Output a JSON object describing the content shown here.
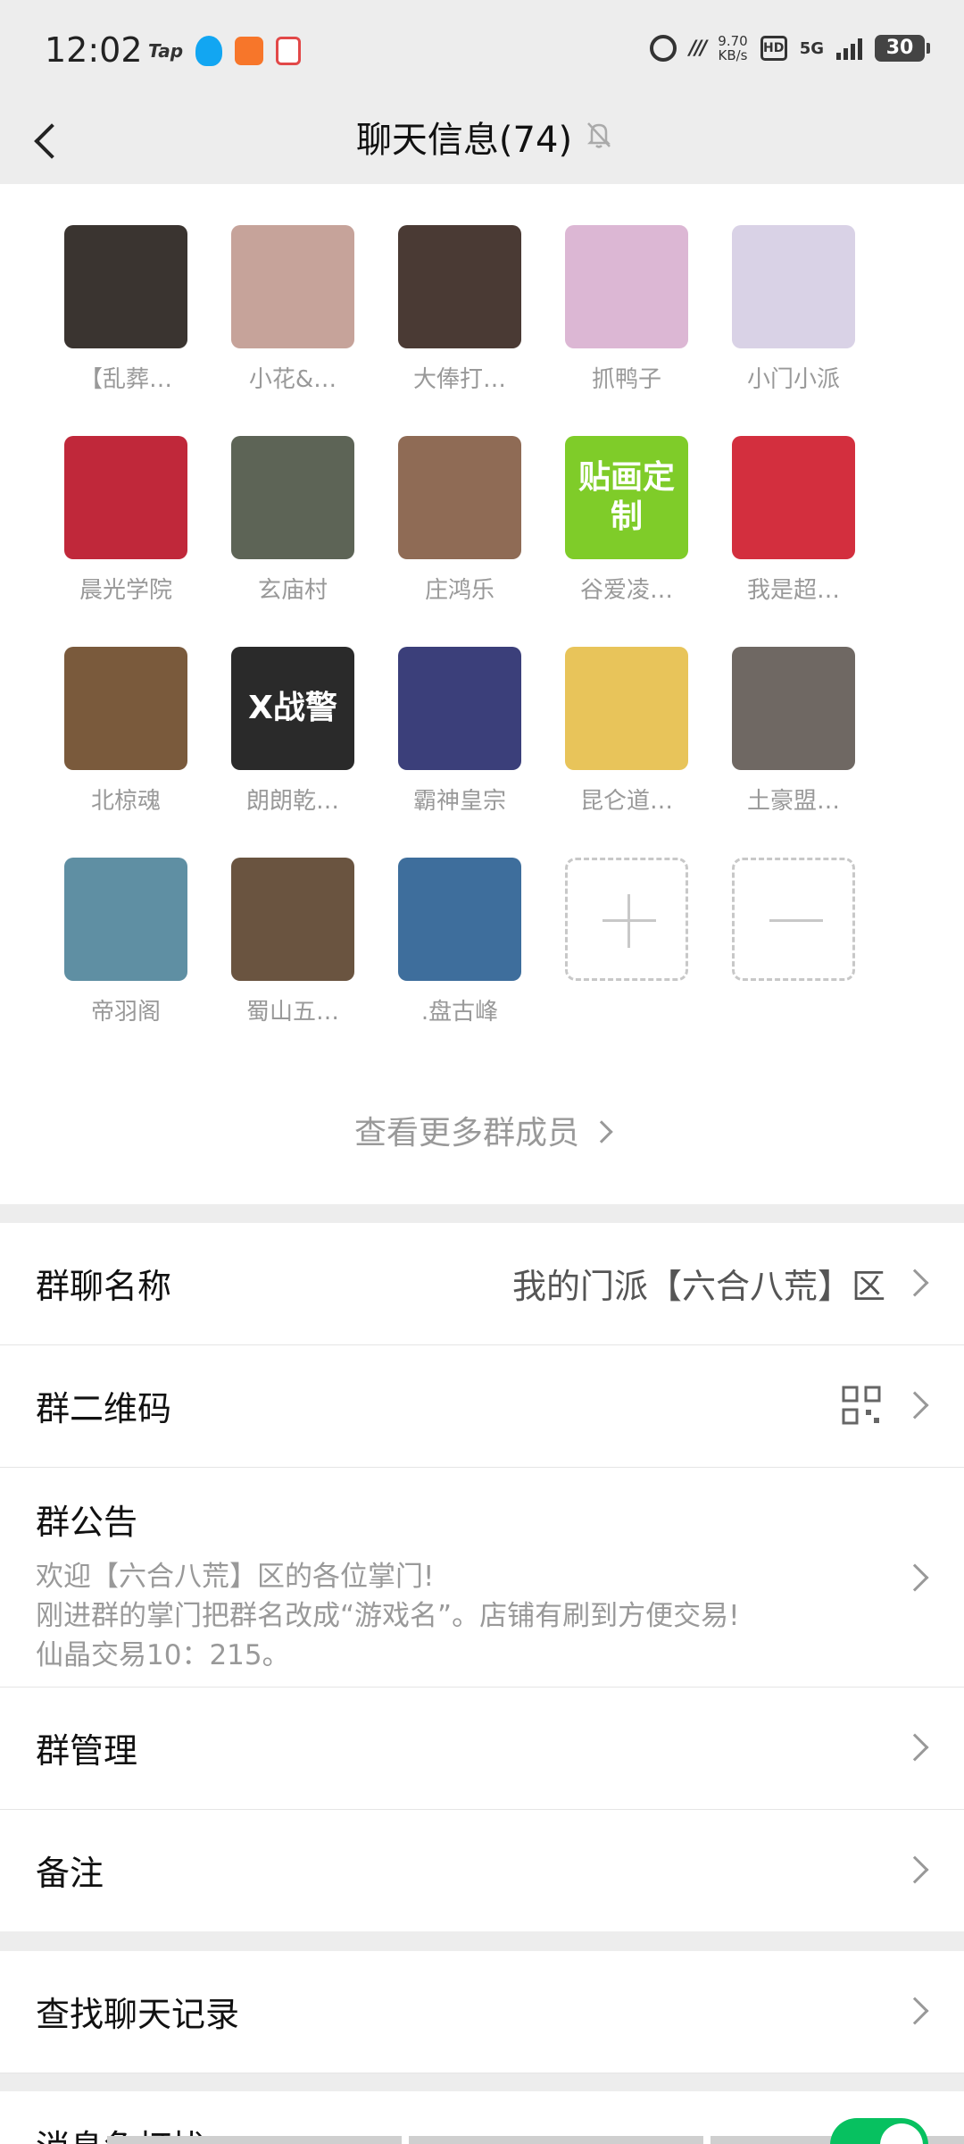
{
  "status_bar": {
    "time": "12:02",
    "app_tap": "Tap",
    "net_speed_value": "9.70",
    "net_speed_unit": "KB/s",
    "hd": "HD",
    "network": "5G",
    "battery": "30"
  },
  "nav": {
    "title": "聊天信息(74)"
  },
  "members": [
    {
      "name": "【乱葬…",
      "color": "#3a3430"
    },
    {
      "name": "小花&…",
      "color": "#c6a39a"
    },
    {
      "name": "大俸打…",
      "color": "#4a3a34"
    },
    {
      "name": "抓鸭子",
      "color": "#dcb7d4"
    },
    {
      "name": "小门小派",
      "color": "#d9d2e6"
    },
    {
      "name": "晨光学院",
      "color": "#c0283a"
    },
    {
      "name": "玄庙村",
      "color": "#5d6456"
    },
    {
      "name": "庄鸿乐",
      "color": "#8f6b55"
    },
    {
      "name": "谷爱凌…",
      "color": "#7fcc29",
      "avatar_text": "贴画定制"
    },
    {
      "name": "我是超…",
      "color": "#d32f3e"
    },
    {
      "name": "北椋魂",
      "color": "#7a5a3c"
    },
    {
      "name": "朗朗乾…",
      "color": "#2a2a2a",
      "avatar_text": "X战警"
    },
    {
      "name": "霸神皇宗",
      "color": "#3b3f7a"
    },
    {
      "name": "昆仑道…",
      "color": "#e8c45a"
    },
    {
      "name": "土豪盟…",
      "color": "#6f6863"
    },
    {
      "name": "帝羽阁",
      "color": "#5f8fa3"
    },
    {
      "name": "蜀山五…",
      "color": "#6a5440"
    },
    {
      "name": ".盘古峰",
      "color": "#3e6e9c"
    }
  ],
  "more_members": "查看更多群成员",
  "settings": {
    "group_name_label": "群聊名称",
    "group_name_value": "我的门派【六合八荒】区",
    "qr_label": "群二维码",
    "notice_label": "群公告",
    "notice_line1": "欢迎【六合八荒】区的各位掌门!",
    "notice_line2": "刚进群的掌门把群名改成“游戏名”。店铺有刷到方便交易!",
    "notice_line3": "仙晶交易10：215。",
    "manage_label": "群管理",
    "remark_label": "备注",
    "search_label": "查找聊天记录",
    "partial_label": "消息免打扰"
  }
}
